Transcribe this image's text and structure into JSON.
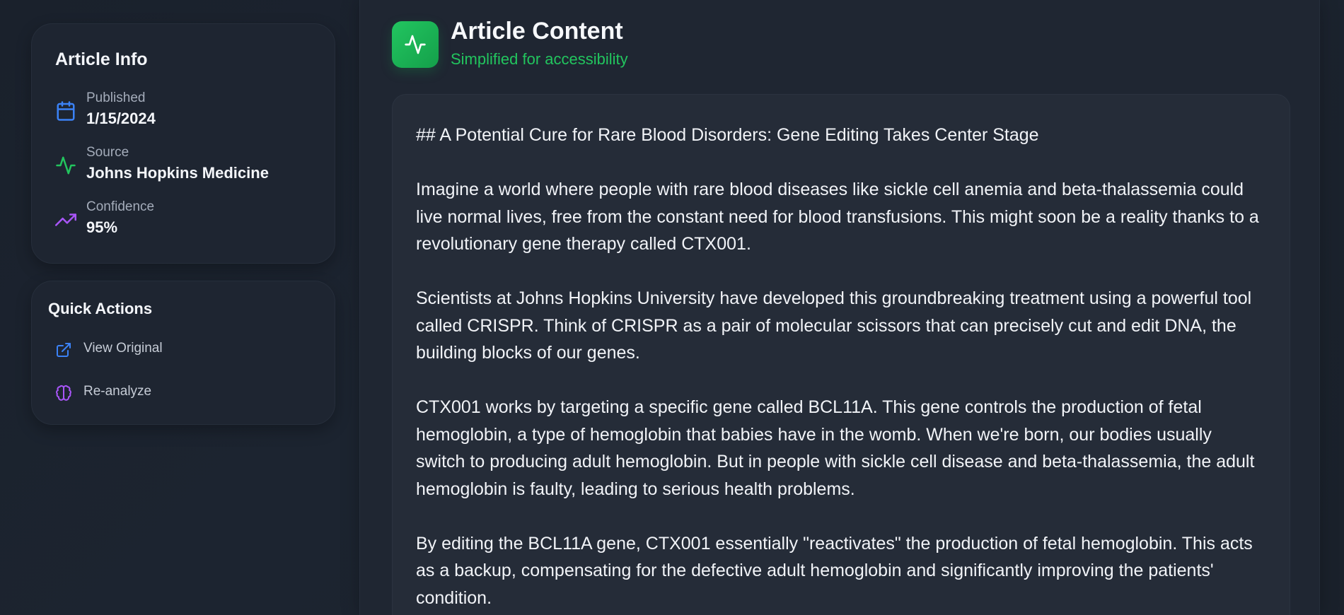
{
  "sidebar": {
    "article_info": {
      "title": "Article Info",
      "published": {
        "label": "Published",
        "value": "1/15/2024",
        "icon": "calendar-icon",
        "color": "#3b82f6"
      },
      "source": {
        "label": "Source",
        "value": "Johns Hopkins Medicine",
        "icon": "activity-icon",
        "color": "#22c55e"
      },
      "confidence": {
        "label": "Confidence",
        "value": "95%",
        "icon": "trending-up-icon",
        "color": "#a855f7"
      }
    },
    "quick_actions": {
      "title": "Quick Actions",
      "items": [
        {
          "label": "View Original",
          "icon": "external-link-icon",
          "color": "#3b82f6"
        },
        {
          "label": "Re-analyze",
          "icon": "brain-icon",
          "color": "#a855f7"
        }
      ]
    }
  },
  "main": {
    "header": {
      "title": "Article Content",
      "subtitle": "Simplified for accessibility",
      "icon": "activity-icon",
      "accent": "#22c55e"
    },
    "article": {
      "paragraphs": [
        "## A Potential Cure for Rare Blood Disorders: Gene Editing Takes Center Stage",
        "Imagine a world where people with rare blood diseases like sickle cell anemia and beta-thalassemia could live normal lives, free from the constant need for blood transfusions. This might soon be a reality thanks to a revolutionary gene therapy called CTX001.",
        "Scientists at Johns Hopkins University have developed this groundbreaking treatment using a powerful tool called CRISPR. Think of CRISPR as a pair of molecular scissors that can precisely cut and edit DNA, the building blocks of our genes.",
        "CTX001 works by targeting a specific gene called BCL11A. This gene controls the production of fetal hemoglobin, a type of hemoglobin that babies have in the womb. When we're born, our bodies usually switch to producing adult hemoglobin. But in people with sickle cell disease and beta-thalassemia, the adult hemoglobin is faulty, leading to serious health problems.",
        "By editing the BCL11A gene, CTX001 essentially \"reactivates\" the production of fetal hemoglobin. This acts as a backup, compensating for the defective adult hemoglobin and significantly improving the patients' condition."
      ]
    }
  }
}
